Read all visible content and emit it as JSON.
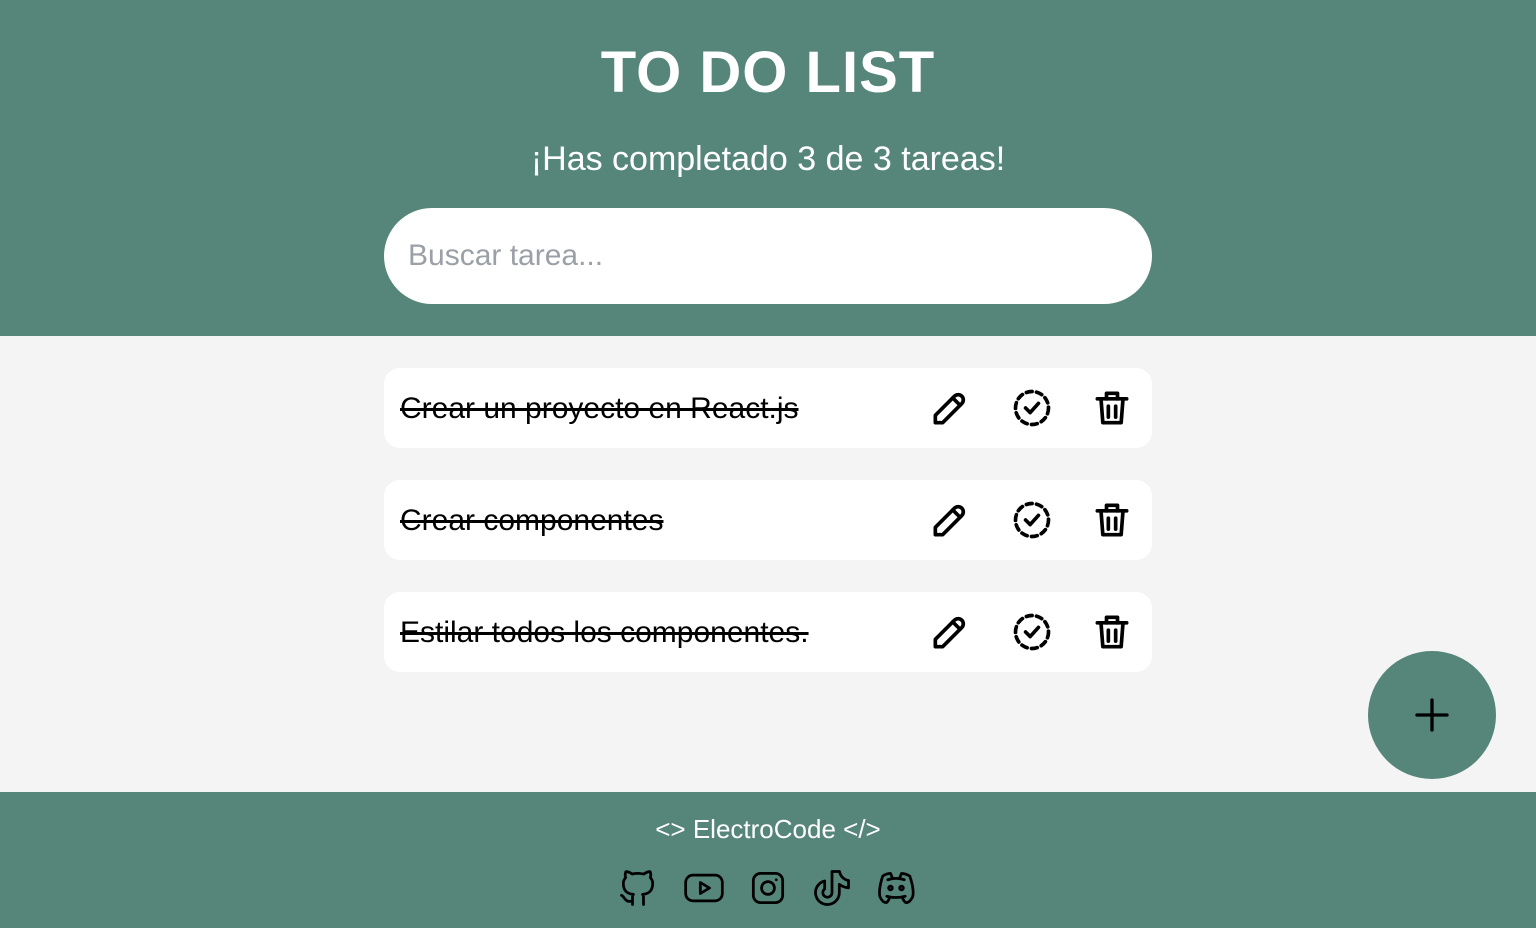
{
  "header": {
    "title": "TO DO LIST",
    "counter_text": "¡Has completado 3 de 3 tareas!",
    "search": {
      "placeholder": "Buscar tarea...",
      "value": ""
    }
  },
  "tasks": [
    {
      "text": "Crear un proyecto en React.js",
      "completed": true
    },
    {
      "text": "Crear componentes",
      "completed": true
    },
    {
      "text": "Estilar todos los componentes.",
      "completed": true
    }
  ],
  "task_actions": {
    "edit_icon": "pencil-icon",
    "complete_icon": "dashed-check-circle-icon",
    "delete_icon": "trash-icon"
  },
  "fab": {
    "icon": "plus-icon"
  },
  "footer": {
    "brand": "<> ElectroCode </>",
    "socials": [
      {
        "name": "github-icon"
      },
      {
        "name": "youtube-icon"
      },
      {
        "name": "instagram-icon"
      },
      {
        "name": "tiktok-icon"
      },
      {
        "name": "discord-icon"
      }
    ]
  },
  "colors": {
    "brand_green": "#56857a",
    "background": "#f4f4f4",
    "card": "#ffffff"
  }
}
